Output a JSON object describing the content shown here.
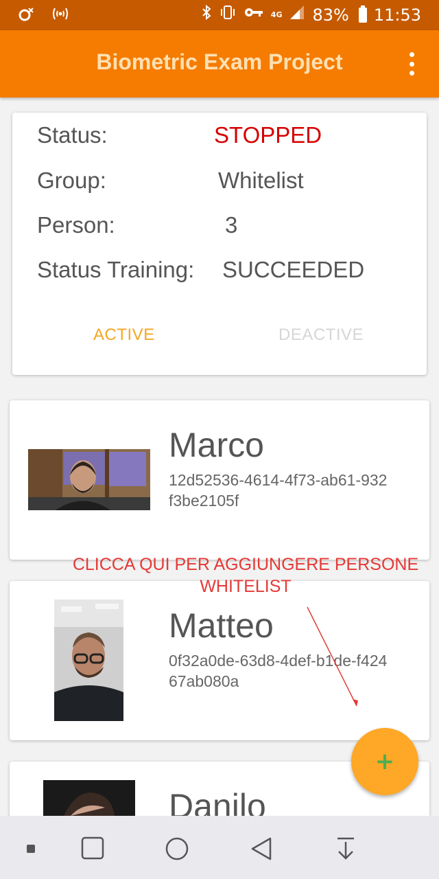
{
  "statusbar": {
    "battery_percent": "83%",
    "time": "11:53",
    "network": "4G",
    "left_icons": [
      "notification-icon",
      "wifi-hotspot-icon"
    ],
    "right_icons": [
      "bluetooth-icon",
      "vibrate-icon",
      "key-icon",
      "signal-icon",
      "battery-icon"
    ]
  },
  "appbar": {
    "title": "Biometric Exam Project",
    "menu_icon": "more-vert-icon"
  },
  "status_card": {
    "status_label": "Status:",
    "status_value": "STOPPED",
    "group_label": "Group:",
    "group_value": "Whitelist",
    "person_label": "Person:",
    "person_value": "3",
    "training_label": "Status Training:",
    "training_value": "SUCCEEDED",
    "active_button": "ACTIVE",
    "deactive_button": "DEACTIVE"
  },
  "persons": [
    {
      "name": "Marco",
      "id": "12d52536-4614-4f73-ab61-932f3be2105f"
    },
    {
      "name": "Matteo",
      "id": "0f32a0de-63d8-4def-b1de-f42467ab080a"
    },
    {
      "name": "Danilo",
      "id": ""
    }
  ],
  "annotation": {
    "line1": "CLICCA QUI PER AGGIUNGERE PERSONE",
    "line2": "WHITELIST"
  },
  "fab": {
    "label": "+"
  },
  "navbar": {
    "items": [
      "dot-icon",
      "recents-icon",
      "home-icon",
      "back-icon",
      "notification-pull-icon"
    ]
  },
  "colors": {
    "appbar": "#f57c00",
    "statusbar": "#c65a00",
    "stopped": "#d50000",
    "active": "#f5a623",
    "fab": "#ffa726",
    "annotation": "#e53935"
  }
}
